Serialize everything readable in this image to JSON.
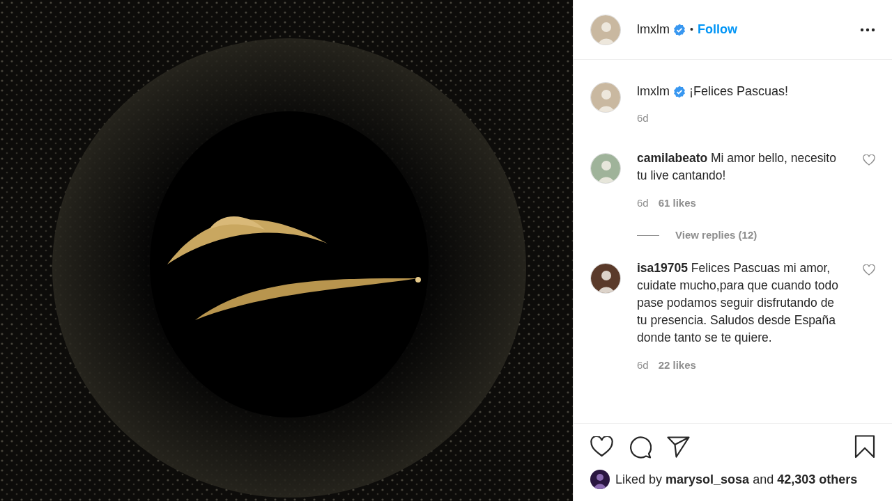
{
  "header": {
    "username": "lmxlm",
    "verified": true,
    "separator": "•",
    "follow": "Follow"
  },
  "caption": {
    "username": "lmxlm",
    "verified": true,
    "text": "¡Felices Pascuas!",
    "time": "6d"
  },
  "comments": [
    {
      "text": "**camilabeato** Mi amor bello, necesito tu live cantando!",
      "time": "6d",
      "likes": "61 likes",
      "replies": "View replies (12)"
    },
    {
      "text": "**isa19705** Felices Pascuas mi amor, cuidate mucho,para que cuando todo pase podamos seguir disfrutando de tu presencia. Saludos desde España donde tanto se te quiere.",
      "time": "6d",
      "likes": "22 likes"
    }
  ],
  "liked_by": "Liked by **marysol_sosa** and **42,303 others**"
}
